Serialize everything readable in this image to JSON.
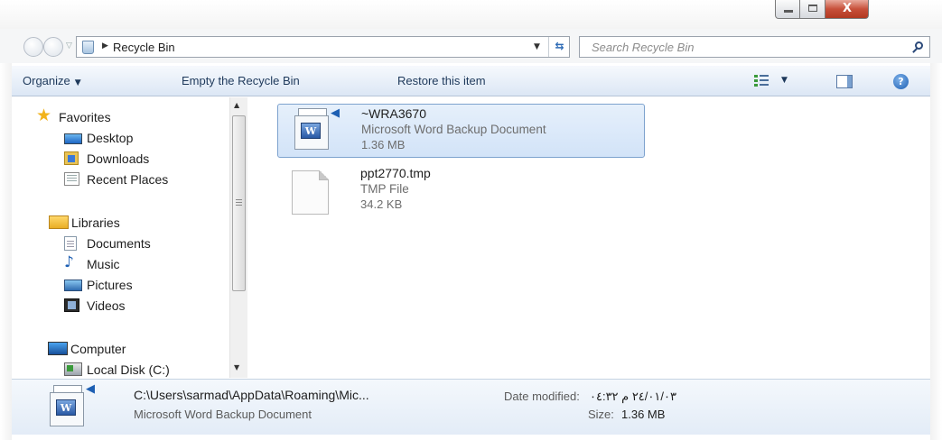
{
  "titlebar": {
    "minimize_icon": "minimize-icon",
    "maximize_icon": "maximize-icon",
    "close_glyph": "X"
  },
  "address": {
    "location": "Recycle Bin",
    "search_placeholder": "Search Recycle Bin"
  },
  "toolbar": {
    "organize": "Organize",
    "empty": "Empty the Recycle Bin",
    "restore": "Restore this item",
    "help_glyph": "?"
  },
  "nav": {
    "favorites": {
      "label": "Favorites",
      "items": [
        "Desktop",
        "Downloads",
        "Recent Places"
      ]
    },
    "libraries": {
      "label": "Libraries",
      "items": [
        "Documents",
        "Music",
        "Pictures",
        "Videos"
      ]
    },
    "computer": {
      "label": "Computer",
      "items": [
        "Local Disk (C:)"
      ]
    }
  },
  "files": [
    {
      "name": "~WRA3670",
      "type": "Microsoft Word Backup Document",
      "size": "1.36 MB",
      "selected": true,
      "icon": "word-backup-icon"
    },
    {
      "name": "ppt2770.tmp",
      "type": "TMP File",
      "size": "34.2 KB",
      "selected": false,
      "icon": "blank-file-icon"
    }
  ],
  "details": {
    "path": "C:\\Users\\sarmad\\AppData\\Roaming\\Mic...",
    "type": "Microsoft Word Backup Document",
    "modified_label": "Date modified:",
    "modified_value": "٢٤/٠١/٠٣ م ٠٤:٣٢",
    "size_label": "Size:",
    "size_value": "1.36 MB"
  },
  "colors": {
    "selection_fill": "#d2e3f8",
    "selection_border": "#7da2ce",
    "command_text": "#1e395b",
    "close_button": "#c7503a"
  }
}
